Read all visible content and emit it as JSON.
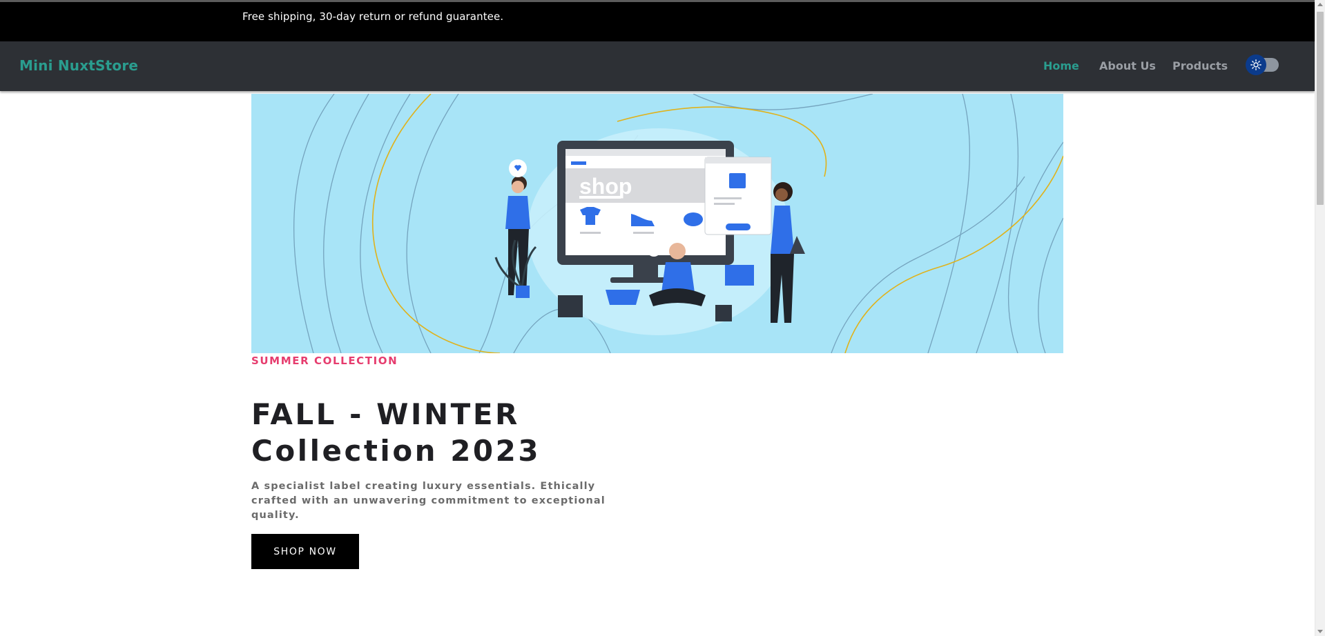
{
  "announcement": {
    "text": "Free shipping, 30-day return or refund guarantee."
  },
  "navbar": {
    "brand": "Mini NuxtStore",
    "links": [
      {
        "label": "Home",
        "active": true
      },
      {
        "label": "About Us",
        "active": false
      },
      {
        "label": "Products",
        "active": false
      }
    ],
    "theme_toggle": {
      "icon": "sun-icon",
      "state": "light"
    }
  },
  "hero": {
    "banner": {
      "icon": "shop-illustration",
      "illustration_text": "shop"
    },
    "eyebrow": "SUMMER COLLECTION",
    "title_line1": "FALL - WINTER",
    "title_line2": "Collection 2023",
    "description": "A specialist label creating luxury essentials. Ethically crafted with an unwavering commitment to exceptional quality.",
    "button_label": "SHOP NOW"
  },
  "colors": {
    "brand": "#2a9d8f",
    "navbar_bg": "#2d3035",
    "announcement_bg": "#000000",
    "eyebrow": "#e63c6e",
    "banner_bg": "#a8e4f7",
    "illustration_accent": "#2f6fe8",
    "toggle_knob": "#0b3b8c"
  }
}
